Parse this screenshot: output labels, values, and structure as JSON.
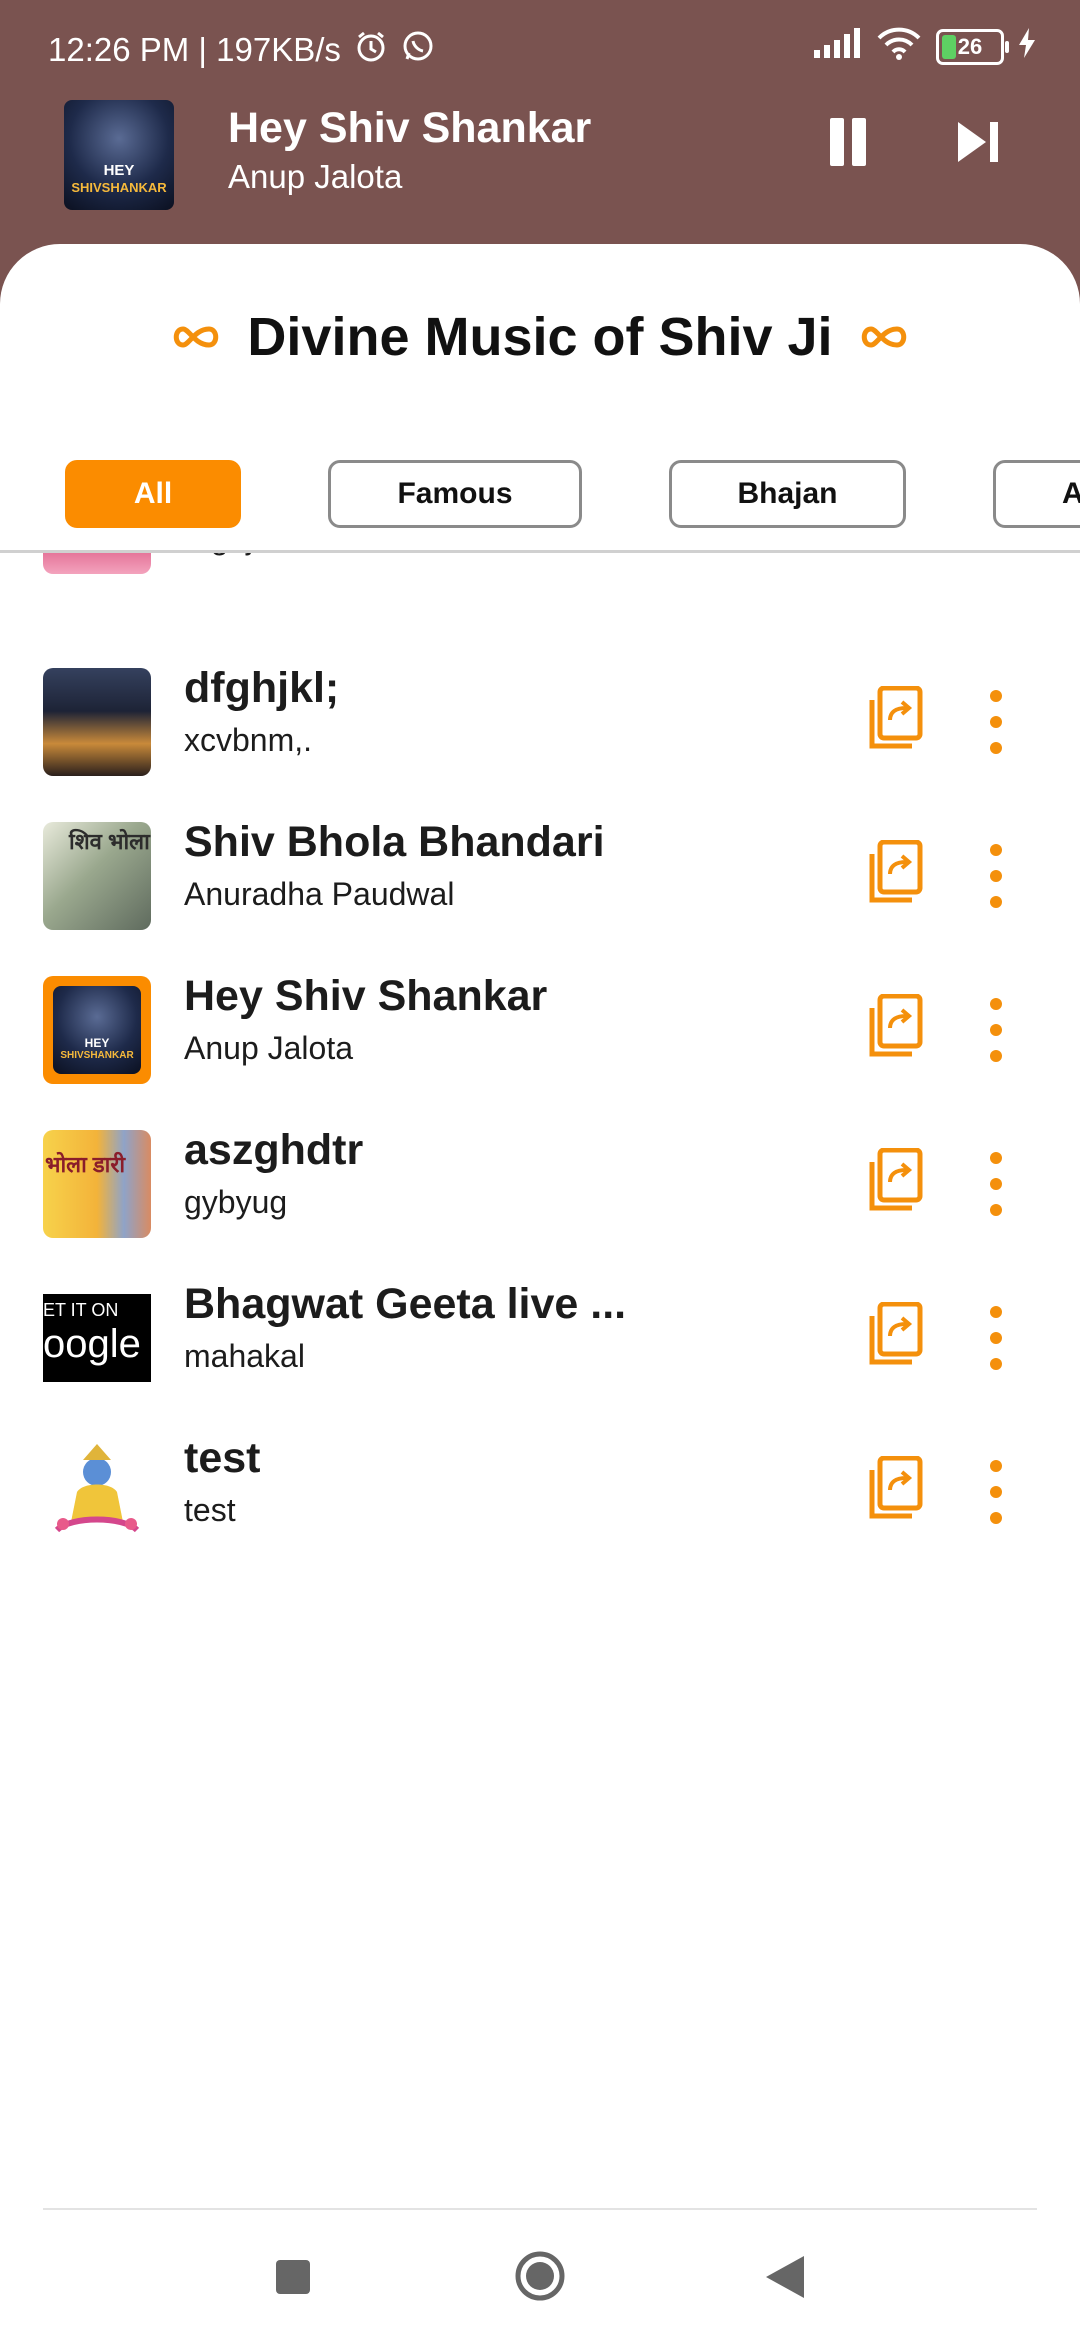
{
  "status_bar": {
    "time_speed": "12:26 PM | 197KB/s",
    "battery_level": "26"
  },
  "now_playing": {
    "title": "Hey Shiv Shankar",
    "artist": "Anup Jalota",
    "thumb_text_1": "HEY",
    "thumb_text_2": "SHIVSHANKAR"
  },
  "page": {
    "heading": "Divine Music of Shiv Ji"
  },
  "filters": [
    {
      "label": "All",
      "active": true
    },
    {
      "label": "Famous",
      "active": false
    },
    {
      "label": "Bhajan",
      "active": false
    },
    {
      "label": "A",
      "active": false
    }
  ],
  "songs": [
    {
      "title": "",
      "artist": "dfghjkl"
    },
    {
      "title": "dfghjkl;",
      "artist": "xcvbnm,."
    },
    {
      "title": "Shiv Bhola Bhandari",
      "artist": "Anuradha Paudwal"
    },
    {
      "title": "Hey Shiv Shankar",
      "artist": "Anup Jalota"
    },
    {
      "title": "aszghdtr",
      "artist": "gybyug"
    },
    {
      "title": "Bhagwat Geeta live ...",
      "artist": "mahakal"
    },
    {
      "title": "test",
      "artist": "test"
    }
  ],
  "thumb_texts": {
    "song3_thumb": "शिव भोला भंडारी",
    "song5_thumb": "भोला डारी",
    "song6_line1": "ET IT ON",
    "song6_line2": "oogle"
  },
  "colors": {
    "accent": "#fb8c00",
    "header_bg": "#7a5350",
    "icon_orange": "#f4900c"
  }
}
